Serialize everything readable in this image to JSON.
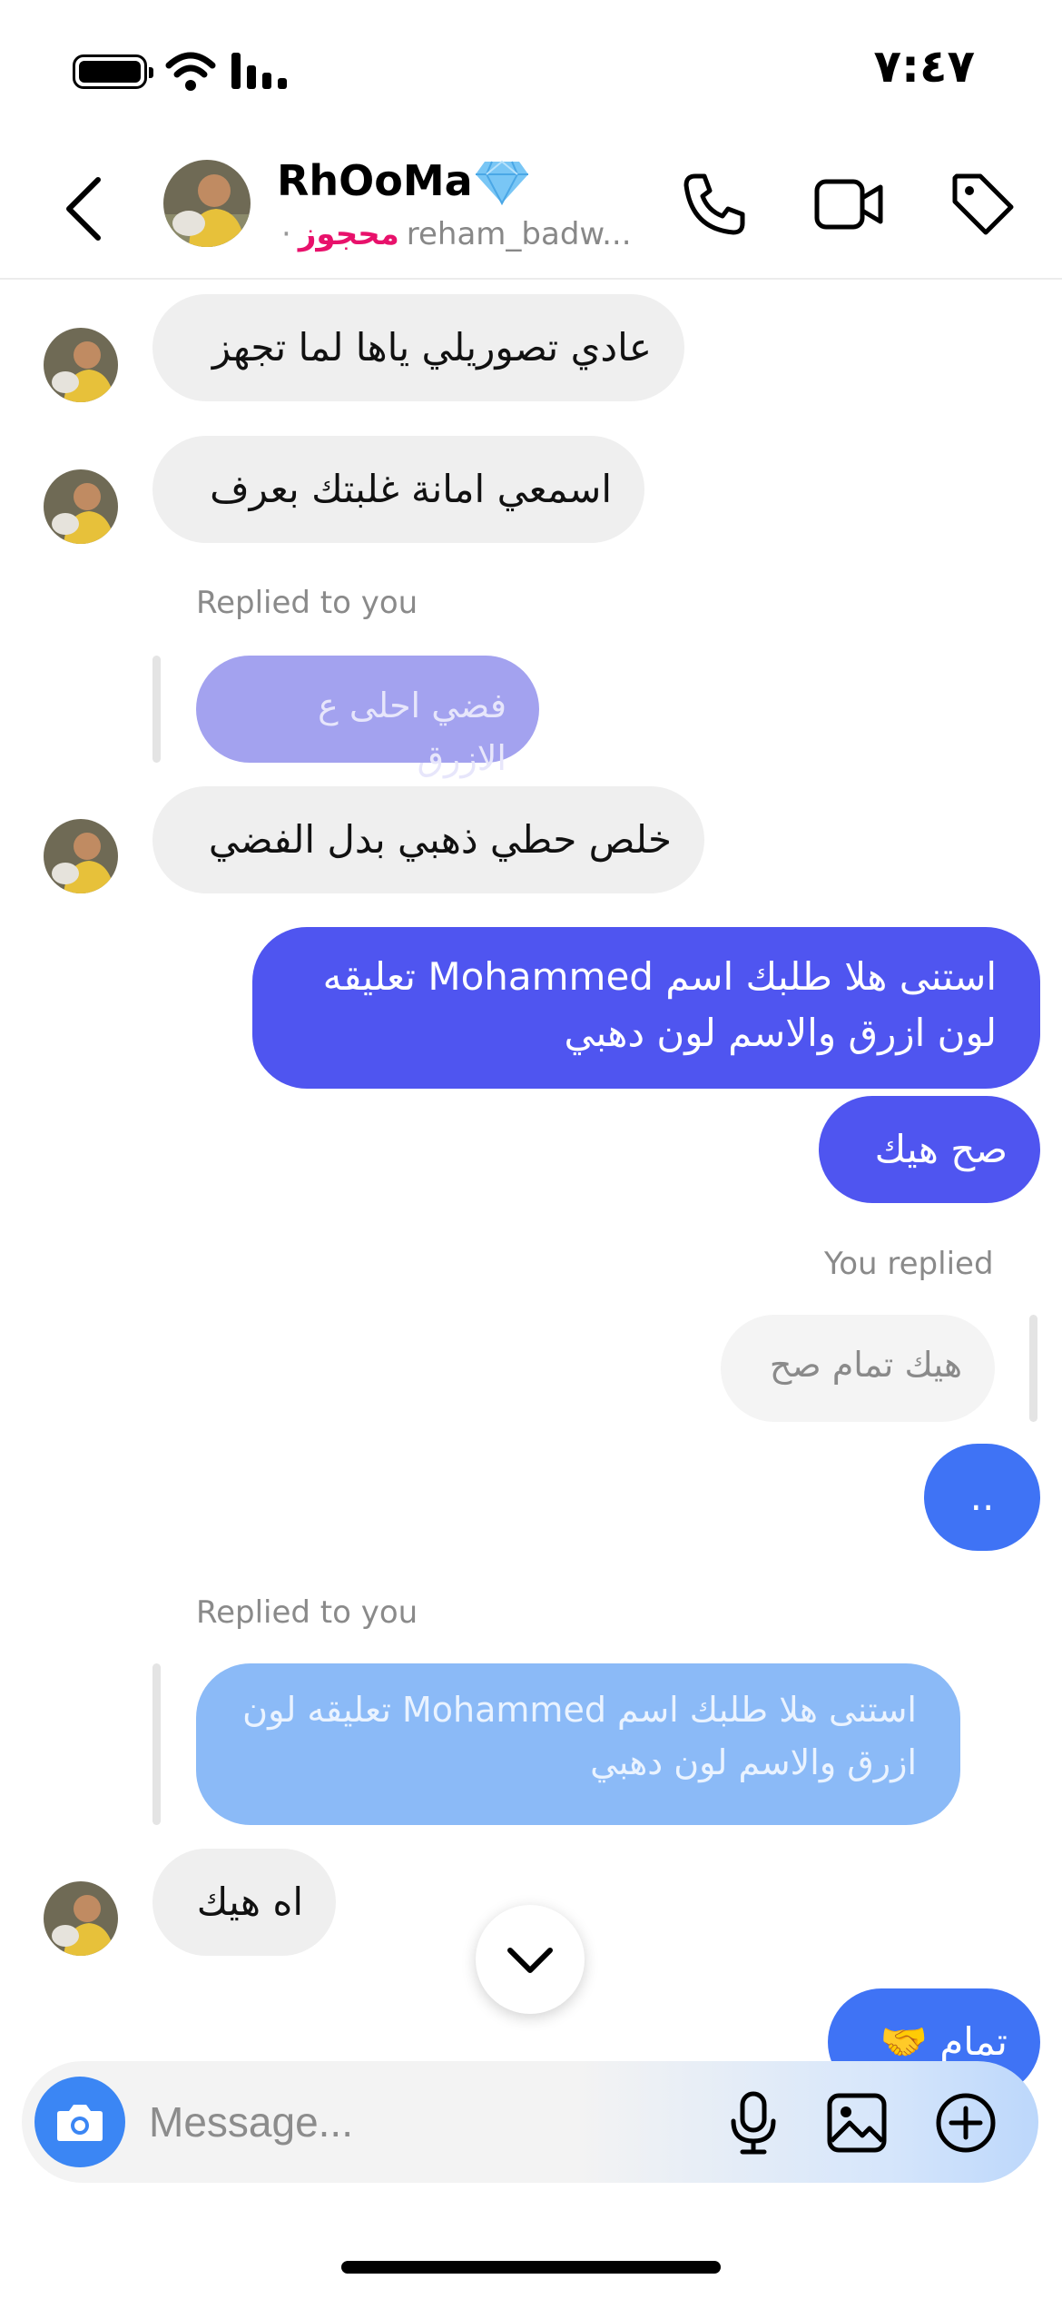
{
  "status_bar": {
    "time": "٧:٤٧"
  },
  "header": {
    "name": "RhOoMa",
    "username": "reham_badw...",
    "dot": "·",
    "status": "محجوز"
  },
  "messages": {
    "m1": "عادي تصوريلي ياها لما تجهز",
    "m2": "اسمعي امانة غلبتك بعرف",
    "reply1_label": "Replied to you",
    "reply1_quote": "فضي احلى ع الازرق",
    "m3": "خلص حطي ذهبي بدل الفضي",
    "m4_line1": "استنى هلا طلبك اسم Mohammed تعليقه",
    "m4_line2": "لون ازرق والاسم لون دهبي",
    "m5": "صح هيك",
    "reply2_label": "You replied",
    "reply2_quote": "هيك تمام صح",
    "m6": "..",
    "reply3_label": "Replied to you",
    "reply3_quote_line1": "استنى هلا طلبك اسم Mohammed تعليقه لون",
    "reply3_quote_line2": "ازرق والاسم لون دهبي",
    "m7": "اه هيك",
    "m8": "تمام 🤝"
  },
  "composer": {
    "placeholder": "Message..."
  }
}
